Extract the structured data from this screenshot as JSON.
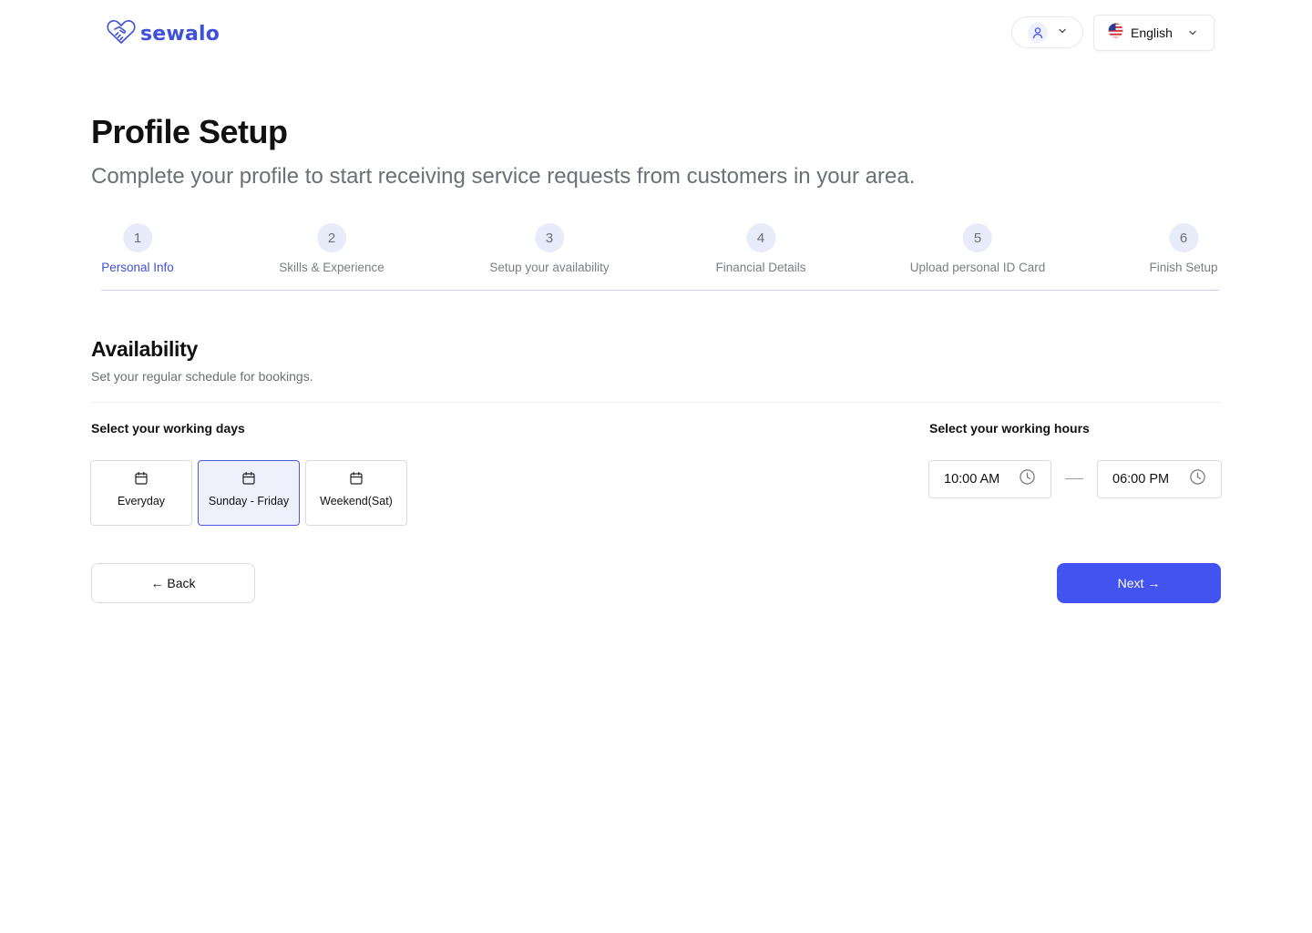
{
  "header": {
    "logo_text": "sewalo",
    "logo_icon": "handshake-heart-icon",
    "user_icon": "user-icon",
    "language": {
      "label": "English",
      "flag_icon": "us-flag-icon"
    }
  },
  "page": {
    "title": "Profile Setup",
    "subtitle": "Complete your profile to start receiving service requests from customers in your area."
  },
  "stepper": {
    "active_step": 1,
    "steps": [
      {
        "number": "1",
        "label": "Personal Info"
      },
      {
        "number": "2",
        "label": "Skills & Experience"
      },
      {
        "number": "3",
        "label": "Setup your availability"
      },
      {
        "number": "4",
        "label": "Financial Details"
      },
      {
        "number": "5",
        "label": "Upload personal ID Card"
      },
      {
        "number": "6",
        "label": "Finish Setup"
      }
    ]
  },
  "availability": {
    "title": "Availability",
    "description": "Set your regular schedule for bookings.",
    "days_label": "Select your working days",
    "hours_label": "Select your working hours",
    "day_options": [
      {
        "label": "Everyday",
        "icon": "calendar-icon",
        "selected": false
      },
      {
        "label": "Sunday - Friday",
        "icon": "calendar-icon",
        "selected": true
      },
      {
        "label": "Weekend(Sat)",
        "icon": "calendar-icon",
        "selected": false
      }
    ],
    "start_time": "10:00 AM",
    "end_time": "06:00 PM",
    "time_icon": "clock-icon"
  },
  "actions": {
    "back_label": "← Back",
    "next_label": "Next →"
  },
  "colors": {
    "primary": "#4353F0",
    "brand": "#3F51D8",
    "step_circle": "#E8EBFA",
    "selected_bg": "#EEF0FC"
  }
}
